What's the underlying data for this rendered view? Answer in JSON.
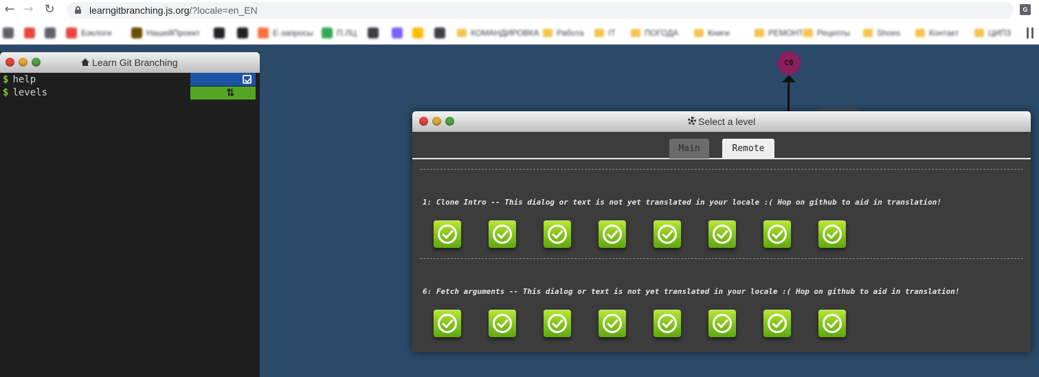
{
  "browser": {
    "url_host": "learngitbranching.js.org",
    "url_path": "/?locale=en_EN",
    "bookmarks": [
      {
        "label": "",
        "color": "#5f6368"
      },
      {
        "label": "",
        "color": "#e8453c"
      },
      {
        "label": "",
        "color": "#5f6368"
      },
      {
        "label": "Бэклоги",
        "color": "#e8453c"
      },
      {
        "label": "НашейПроект",
        "color": "#6a4c00"
      },
      {
        "label": "",
        "color": "#202124"
      },
      {
        "label": "",
        "color": "#202124"
      },
      {
        "label": "Е-запросы",
        "color": "#ff7043"
      },
      {
        "label": "П.ЛЦ",
        "color": "#34a853"
      },
      {
        "label": "",
        "color": "#3c4043"
      },
      {
        "label": "",
        "color": "#7b61ff"
      },
      {
        "label": "",
        "color": "#fbbc04"
      },
      {
        "label": "",
        "color": "#3c4043"
      },
      {
        "label": "КОМАНДИРОВКА",
        "folder": true
      },
      {
        "label": "Работа",
        "folder": true
      },
      {
        "label": "IT",
        "folder": true
      },
      {
        "label": "ПОГОДА",
        "folder": true
      },
      {
        "label": "Книги",
        "folder": true
      },
      {
        "label": "РЕМОНТ",
        "folder": true
      },
      {
        "label": "Рецепты",
        "folder": true
      },
      {
        "label": "Shoes",
        "folder": true
      },
      {
        "label": "Контакт",
        "folder": true
      },
      {
        "label": "ЦИПЗ",
        "folder": true
      }
    ]
  },
  "terminal": {
    "title": "Learn Git Branching",
    "prompt": "$",
    "commands": [
      "help",
      "levels"
    ]
  },
  "visualization": {
    "commit_label": "C0",
    "commit_color": "#8a1f5a"
  },
  "dialog": {
    "title": "Select a level",
    "tabs": [
      {
        "label": "Main",
        "active": false
      },
      {
        "label": "Remote",
        "active": true
      }
    ],
    "sequences": [
      {
        "title": "1: Clone Intro -- This dialog or text is not yet translated in your locale :( Hop on github to aid in translation!",
        "level_count": 8,
        "completed": true
      },
      {
        "title": "6: Fetch arguments -- This dialog or text is not yet translated in your locale :( Hop on github to aid in translation!",
        "level_count": 8,
        "completed": true
      }
    ]
  },
  "colors": {
    "background": "#2b4a69",
    "level_complete": "#86c51d",
    "status_blue": "#1e52a4",
    "status_green": "#54a524"
  }
}
